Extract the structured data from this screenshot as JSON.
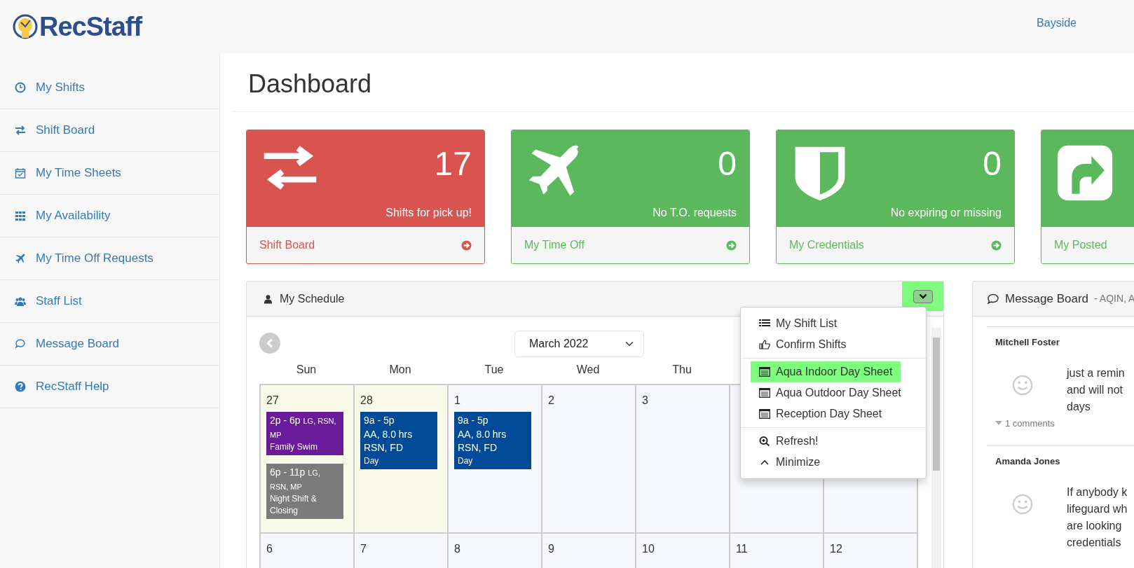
{
  "brand": {
    "name": "RecStaff"
  },
  "user_menu": {
    "label": "Bayside"
  },
  "sidebar": {
    "items": [
      {
        "label": "My Shifts"
      },
      {
        "label": "Shift Board"
      },
      {
        "label": "My Time Sheets"
      },
      {
        "label": "My Availability"
      },
      {
        "label": "My Time Off Requests"
      },
      {
        "label": "Staff List"
      },
      {
        "label": "Message Board"
      },
      {
        "label": "RecStaff Help"
      }
    ]
  },
  "page": {
    "title": "Dashboard"
  },
  "stat_cards": [
    {
      "count": "17",
      "caption": "Shifts for pick up!",
      "link": "Shift Board",
      "color": "#d9534f"
    },
    {
      "count": "0",
      "caption": "No T.O. requests",
      "link": "My Time Off",
      "color": "#5cb85c"
    },
    {
      "count": "0",
      "caption": "No expiring or missing",
      "link": "My Credentials",
      "color": "#5cb85c"
    },
    {
      "link": "My Posted",
      "color": "#5cb85c"
    }
  ],
  "schedule": {
    "title": "My Schedule",
    "menu_button": {
      "highlighted": true
    },
    "month_select": {
      "value": "March 2022"
    },
    "weekdays": [
      "Sun",
      "Mon",
      "Tue",
      "Wed",
      "Thu"
    ],
    "weeks": [
      {
        "days": [
          {
            "date": "27",
            "other_month": true,
            "events": [
              {
                "time": "2p - 6p",
                "roles": "LG, RSN, MP",
                "note": "Family Swim",
                "color": "#6a1b9a"
              },
              {
                "time": "6p - 11p",
                "roles": "LG, RSN, MP",
                "note": "Night Shift & Closing",
                "color": "#7b7b7b"
              }
            ]
          },
          {
            "date": "28",
            "other_month": true,
            "events": [
              {
                "time": "9a - 5p",
                "lines": [
                  "AA, 8.0 hrs",
                  "RSN, FD"
                ],
                "note": "Day",
                "color": "#004a97"
              }
            ]
          },
          {
            "date": "1",
            "other_month": false,
            "events": [
              {
                "time": "9a - 5p",
                "lines": [
                  "AA, 8.0 hrs",
                  "RSN, FD"
                ],
                "note": "Day",
                "color": "#004a97"
              }
            ]
          },
          {
            "date": "2",
            "other_month": false
          },
          {
            "date": "3",
            "other_month": false
          },
          {
            "other_month": false
          },
          {
            "other_month": false
          }
        ]
      },
      {
        "days": [
          {
            "date": "6",
            "other_month": false
          },
          {
            "date": "7",
            "other_month": false
          },
          {
            "date": "8",
            "other_month": false
          },
          {
            "date": "9",
            "other_month": false
          },
          {
            "date": "10",
            "other_month": false
          },
          {
            "date": "11",
            "other_month": false
          },
          {
            "date": "12",
            "other_month": false
          }
        ]
      }
    ],
    "menu": {
      "groups": [
        [
          {
            "label": "My Shift List",
            "highlighted": false
          },
          {
            "label": "Confirm Shifts",
            "highlighted": false
          }
        ],
        [
          {
            "label": "Aqua Indoor Day Sheet",
            "highlighted": true
          },
          {
            "label": "Aqua Outdoor Day Sheet",
            "highlighted": false
          },
          {
            "label": "Reception Day Sheet",
            "highlighted": false
          }
        ],
        [
          {
            "label": "Refresh!",
            "highlighted": false
          },
          {
            "label": "Minimize",
            "highlighted": false
          }
        ]
      ]
    }
  },
  "message_board": {
    "title": "Message Board",
    "subtitle": "- AQIN, A",
    "posts": [
      {
        "author": "Mitchell Foster",
        "lines": [
          "just a remin",
          "and will not",
          "days"
        ],
        "comments": "1 comments"
      },
      {
        "author": "Amanda Jones",
        "lines": [
          "If anybody k",
          "lifeguard wh",
          "are looking",
          "credentials"
        ]
      }
    ]
  }
}
